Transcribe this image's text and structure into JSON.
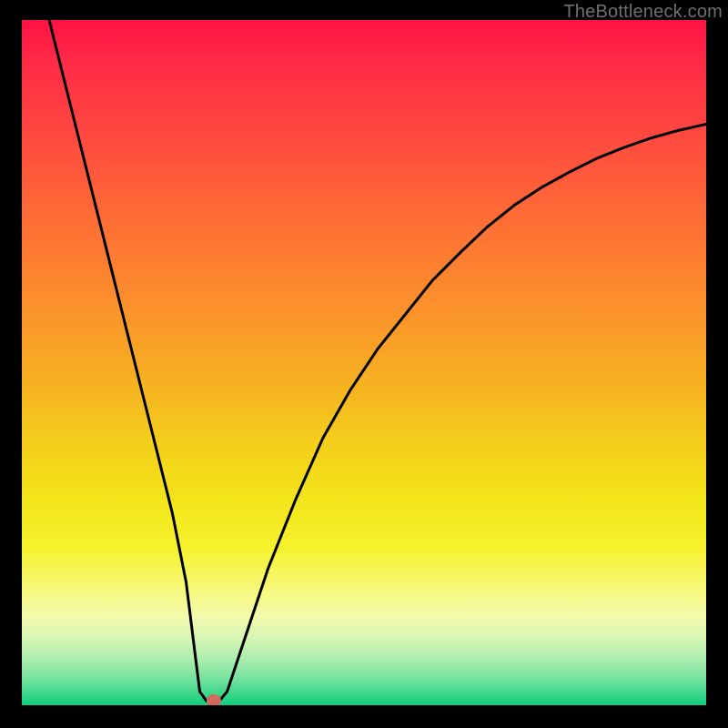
{
  "attribution": "TheBottleneck.com",
  "chart_data": {
    "type": "line",
    "title": "",
    "xlabel": "",
    "ylabel": "",
    "xlim": [
      0,
      100
    ],
    "ylim": [
      0,
      100
    ],
    "series": [
      {
        "name": "bottleneck-curve",
        "x": [
          4,
          6,
          8,
          10,
          12,
          14,
          16,
          18,
          20,
          22,
          24,
          25,
          26,
          27,
          28,
          29,
          30,
          32,
          36,
          40,
          44,
          48,
          52,
          56,
          60,
          64,
          68,
          72,
          76,
          80,
          84,
          88,
          92,
          96,
          100
        ],
        "y": [
          100,
          92,
          84,
          76,
          68,
          60,
          52,
          44,
          36,
          28,
          18,
          10,
          2,
          0.6,
          0.6,
          0.8,
          2,
          8,
          20,
          30,
          39,
          46,
          52,
          57,
          62,
          66,
          69.8,
          73,
          75.6,
          77.8,
          79.8,
          81.4,
          82.8,
          83.9,
          84.8
        ]
      }
    ],
    "marker": {
      "x": 28,
      "y": 0.6
    },
    "gradient_stops": [
      {
        "pct": 0,
        "color": "#ff1344"
      },
      {
        "pct": 18,
        "color": "#ff4c3f"
      },
      {
        "pct": 40,
        "color": "#fc8c2d"
      },
      {
        "pct": 62,
        "color": "#f3cf1b"
      },
      {
        "pct": 83,
        "color": "#f7f97a"
      },
      {
        "pct": 100,
        "color": "#0fcd7e"
      }
    ]
  }
}
